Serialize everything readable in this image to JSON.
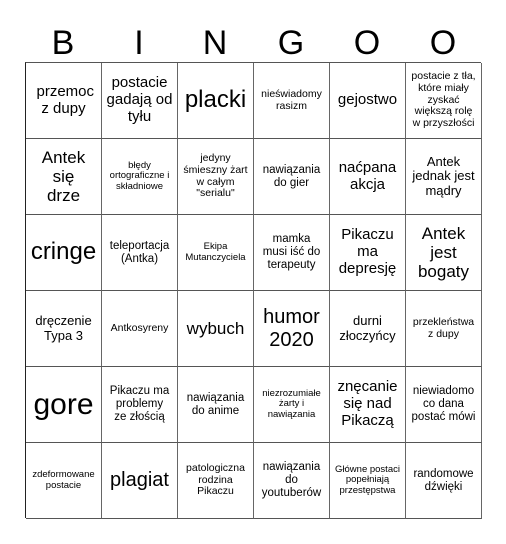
{
  "header": [
    "B",
    "I",
    "N",
    "G",
    "O",
    "O"
  ],
  "cells": [
    [
      "przemoc z dupy",
      "postacie gadają od tyłu",
      "placki",
      "nieświadomy rasizm",
      "gejostwo",
      "postacie z tła, które miały zyskać większą rolę w przyszłości"
    ],
    [
      "Antek się drze",
      "błędy ortograficzne i składniowe",
      "jedyny śmieszny żart w całym \"serialu\"",
      "nawiązania do gier",
      "naćpana akcja",
      "Antek jednak jest mądry"
    ],
    [
      "cringe",
      "teleportacja (Antka)",
      "Ekipa Mutanczyciela",
      "mamka musi iść do terapeuty",
      "Pikaczu ma depresję",
      "Antek jest bogaty"
    ],
    [
      "dręczenie Typa 3",
      "Antkosyreny",
      "wybuch",
      "humor 2020",
      "durni złoczyńcy",
      "przekleństwa z dupy"
    ],
    [
      "gore",
      "Pikaczu ma problemy ze złością",
      "nawiązania do anime",
      "niezrozumiałe żarty i nawiązania",
      "znęcanie się nad Pikaczą",
      "niewiadomo co dana postać mówi"
    ],
    [
      "zdeformowane postacie",
      "plagiat",
      "patologiczna rodzina Pikaczu",
      "nawiązania do youtuberów",
      "Główne postaci popełniają przestępstwa",
      "randomowe dźwięki"
    ]
  ]
}
